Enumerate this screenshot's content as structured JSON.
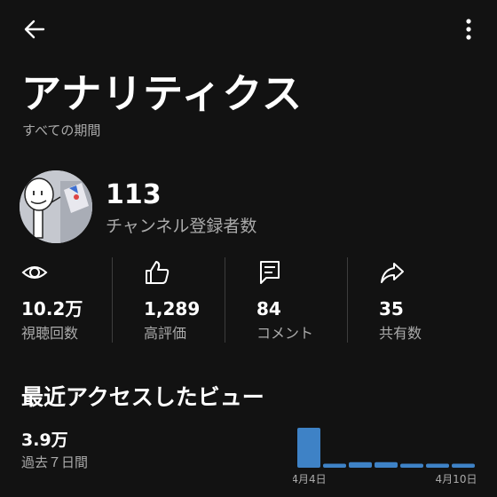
{
  "icons": {
    "back": "arrow-left",
    "more": "vertical-ellipsis",
    "views": "eye",
    "likes": "thumbs-up",
    "comments": "comment",
    "shares": "share-arrow"
  },
  "header": {
    "title": "アナリティクス",
    "subtitle": "すべての期間"
  },
  "subscribers": {
    "count": "113",
    "label": "チャンネル登録者数"
  },
  "stats": [
    {
      "value": "10.2万",
      "label": "視聴回数"
    },
    {
      "value": "1,289",
      "label": "高評価"
    },
    {
      "value": "84",
      "label": "コメント"
    },
    {
      "value": "35",
      "label": "共有数"
    }
  ],
  "recent": {
    "title": "最近アクセスしたビュー",
    "value": "3.9万",
    "period": "過去７日間"
  },
  "colors": {
    "background": "#121212",
    "bar": "#3e82c6",
    "muted_text": "#aaaaaa"
  },
  "chart_data": {
    "type": "bar",
    "tick_labels": [
      "4月4日",
      "4月10日"
    ],
    "relative_values": [
      1.0,
      0.1,
      0.14,
      0.14,
      0.1,
      0.1,
      0.1
    ]
  }
}
